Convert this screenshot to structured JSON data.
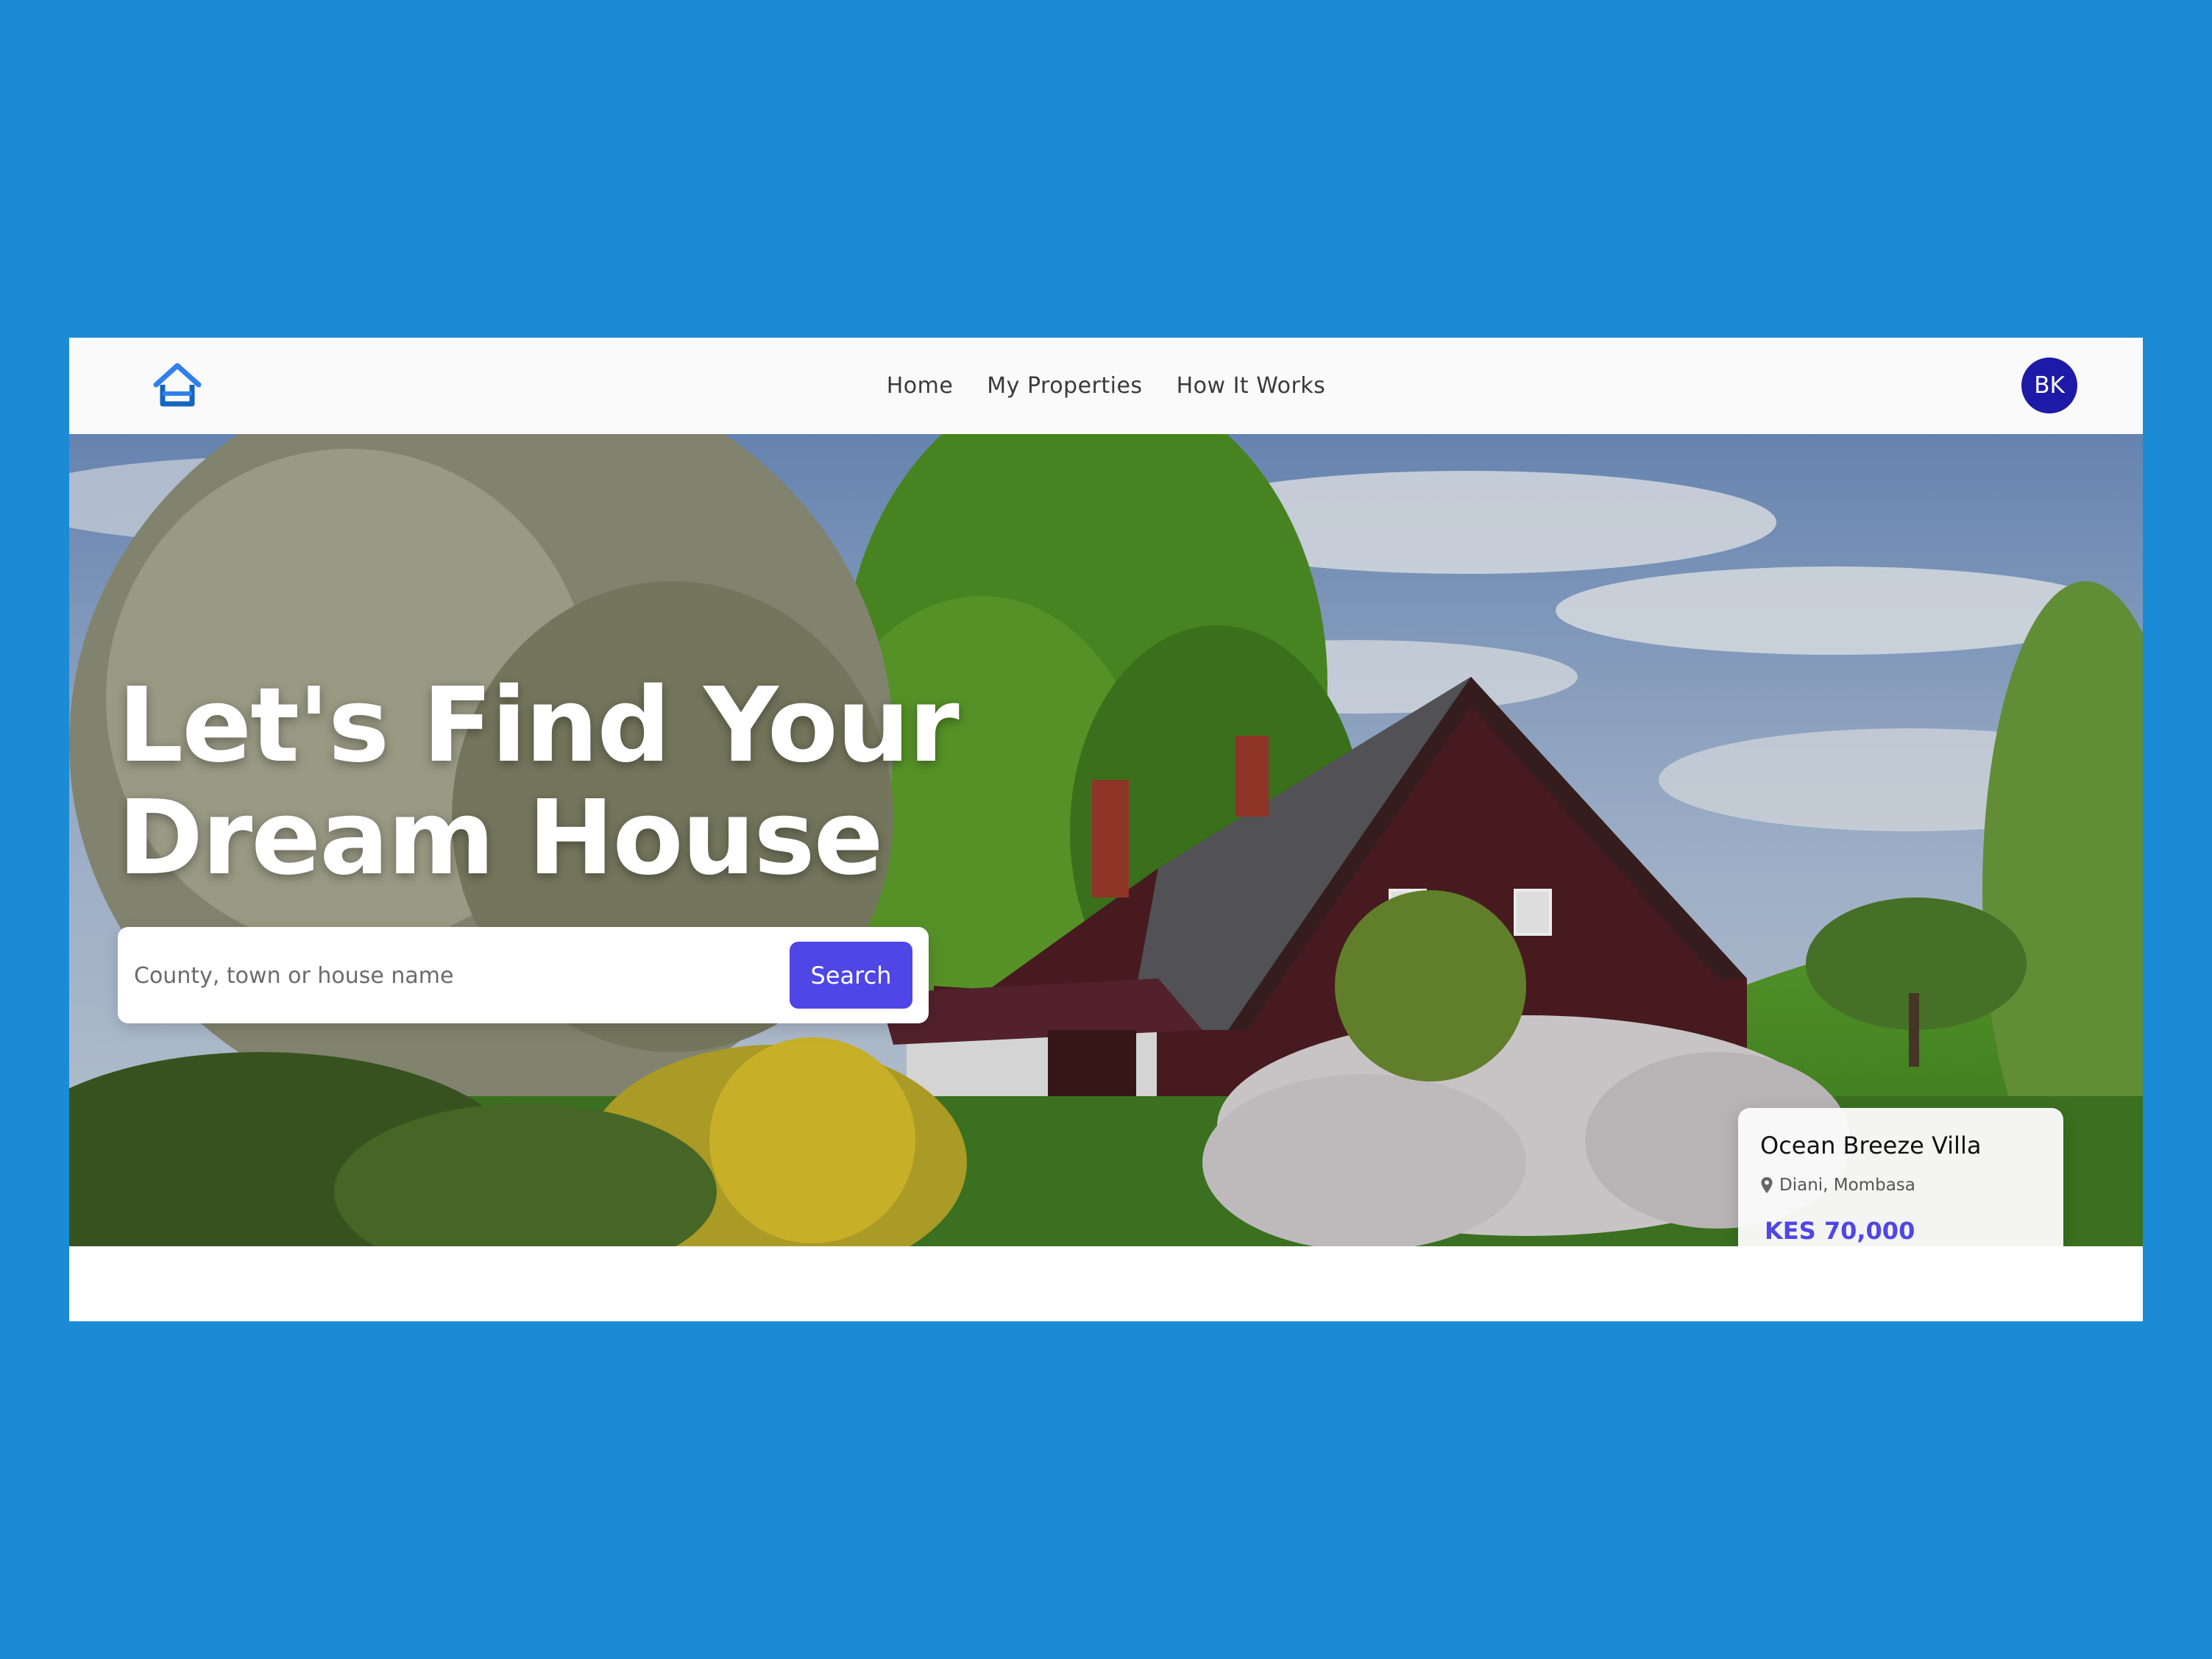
{
  "brand": {
    "logo_icon": "house-icon",
    "accent_color": "#2f80ed"
  },
  "nav": {
    "links": [
      {
        "label": "Home"
      },
      {
        "label": "My Properties"
      },
      {
        "label": "How It Works"
      }
    ]
  },
  "user": {
    "initials": "BK",
    "avatar_color": "#1d1aa8"
  },
  "hero": {
    "title_line1": "Let's Find Your",
    "title_line2": "Dream House",
    "background": "photo of a dark red wooden house with a grey roof, trees, flowering bushes and a cloudy blue sky"
  },
  "search": {
    "placeholder": "County, town or house name",
    "value": "",
    "button_label": "Search",
    "button_color": "#4f46e5"
  },
  "featured_property": {
    "name": "Ocean Breeze Villa",
    "location_icon": "map-pin-icon",
    "location": "Diani, Mombasa",
    "price": "KES 70,000",
    "price_color": "#4f46e5"
  },
  "colors": {
    "page_background": "#1a8bd4",
    "navbar_background": "#fafafa"
  }
}
